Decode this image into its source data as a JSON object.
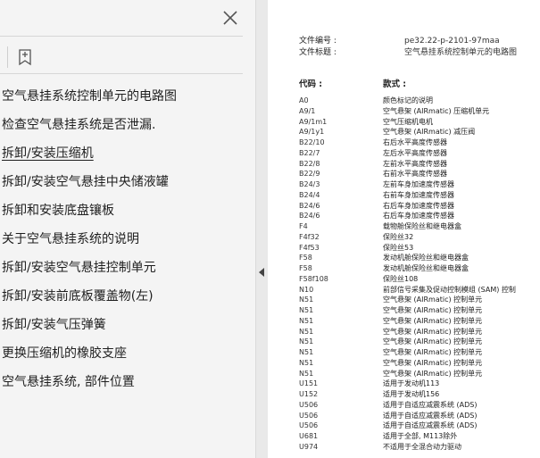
{
  "sidebar": {
    "close_icon": "close-icon",
    "bookmark_icon": "bookmark-icon",
    "items": [
      {
        "label": "空气悬挂系统控制单元的电路图",
        "link": false
      },
      {
        "label": "检查空气悬挂系统是否泄漏.",
        "link": false
      },
      {
        "label": "拆卸/安装压缩机",
        "link": true
      },
      {
        "label": "拆卸/安装空气悬挂中央储液罐",
        "link": false
      },
      {
        "label": "拆卸和安装底盘镶板",
        "link": false
      },
      {
        "label": "关于空气悬挂系统的说明",
        "link": false
      },
      {
        "label": "拆卸/安装空气悬挂控制单元",
        "link": false
      },
      {
        "label": "拆卸/安装前底板覆盖物(左)",
        "link": false
      },
      {
        "label": "拆卸/安装气压弹簧",
        "link": false
      },
      {
        "label": "更换压缩机的橡胶支座",
        "link": false
      },
      {
        "label": "空气悬挂系统, 部件位置",
        "link": false
      }
    ]
  },
  "document": {
    "file_no_label": "文件编号 :",
    "file_no": "pe32.22-p-2101-97maa",
    "file_title_label": "文件标题 :",
    "file_title": "空气悬挂系统控制单元的电路图",
    "col_code": "代码 :",
    "col_desc": "款式 :",
    "rows": [
      {
        "code": "A0",
        "desc": "颜色标记的说明"
      },
      {
        "code": "A9/1",
        "desc": "空气悬架 (AIRmatic) 压缩机单元"
      },
      {
        "code": "A9/1m1",
        "desc": "空气压缩机电机"
      },
      {
        "code": "A9/1y1",
        "desc": "空气悬架 (AIRmatic) 减压阀"
      },
      {
        "code": "B22/10",
        "desc": "右后水平高度传感器"
      },
      {
        "code": "B22/7",
        "desc": "左后水平高度传感器"
      },
      {
        "code": "B22/8",
        "desc": "左前水平高度传感器"
      },
      {
        "code": "B22/9",
        "desc": "右前水平高度传感器"
      },
      {
        "code": "B24/3",
        "desc": "左前车身加速度传感器"
      },
      {
        "code": "B24/4",
        "desc": "右前车身加速度传感器"
      },
      {
        "code": "B24/6",
        "desc": "右后车身加速度传感器"
      },
      {
        "code": "B24/6",
        "desc": "右后车身加速度传感器"
      },
      {
        "code": "F4",
        "desc": "载物舱保险丝和继电器盒"
      },
      {
        "code": "F4f32",
        "desc": "保险丝32"
      },
      {
        "code": "F4f53",
        "desc": "保险丝53"
      },
      {
        "code": "F58",
        "desc": "发动机舱保险丝和继电器盒"
      },
      {
        "code": "F58",
        "desc": "发动机舱保险丝和继电器盒"
      },
      {
        "code": "F58f108",
        "desc": "保险丝108"
      },
      {
        "code": "N10",
        "desc": "前部信号采集及促动控制模组 (SAM) 控制"
      },
      {
        "code": "N51",
        "desc": "空气悬架 (AIRmatic) 控制单元"
      },
      {
        "code": "N51",
        "desc": "空气悬架 (AIRmatic) 控制单元"
      },
      {
        "code": "N51",
        "desc": "空气悬架 (AIRmatic) 控制单元"
      },
      {
        "code": "N51",
        "desc": "空气悬架 (AIRmatic) 控制单元"
      },
      {
        "code": "N51",
        "desc": "空气悬架 (AIRmatic) 控制单元"
      },
      {
        "code": "N51",
        "desc": "空气悬架 (AIRmatic) 控制单元"
      },
      {
        "code": "N51",
        "desc": "空气悬架 (AIRmatic) 控制单元"
      },
      {
        "code": "N51",
        "desc": "空气悬架 (AIRmatic) 控制单元"
      },
      {
        "code": "U151",
        "desc": "适用于发动机113"
      },
      {
        "code": "U152",
        "desc": "适用于发动机156"
      },
      {
        "code": "U506",
        "desc": "适用于自适应减震系统 (ADS)"
      },
      {
        "code": "U506",
        "desc": "适用于自适应减震系统 (ADS)"
      },
      {
        "code": "U506",
        "desc": "适用于自适应减震系统 (ADS)"
      },
      {
        "code": "U681",
        "desc": "适用于全部, M113除外"
      },
      {
        "code": "U974",
        "desc": "不适用于全混合动力驱动"
      }
    ]
  }
}
